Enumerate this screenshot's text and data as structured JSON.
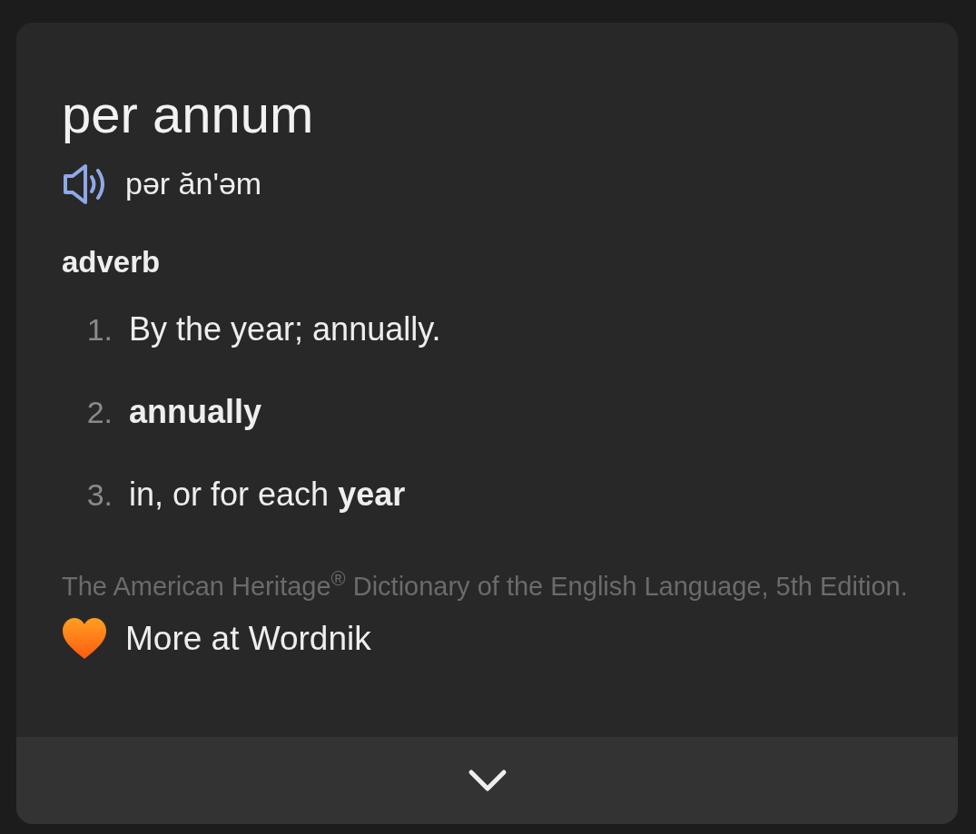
{
  "word": "per annum",
  "pronunciation": "pər ăn'əm",
  "part_of_speech": "adverb",
  "definitions": [
    {
      "number": "1.",
      "text": "By the year; annually.",
      "bold": false
    },
    {
      "number": "2.",
      "text": "annually",
      "bold": true
    },
    {
      "number": "3.",
      "text": "in, or for each **year**",
      "bold": false
    }
  ],
  "source": "The American Heritage$^{®}$ Dictionary of the English Language, 5th Edition.",
  "more_link": "More at Wordnik"
}
